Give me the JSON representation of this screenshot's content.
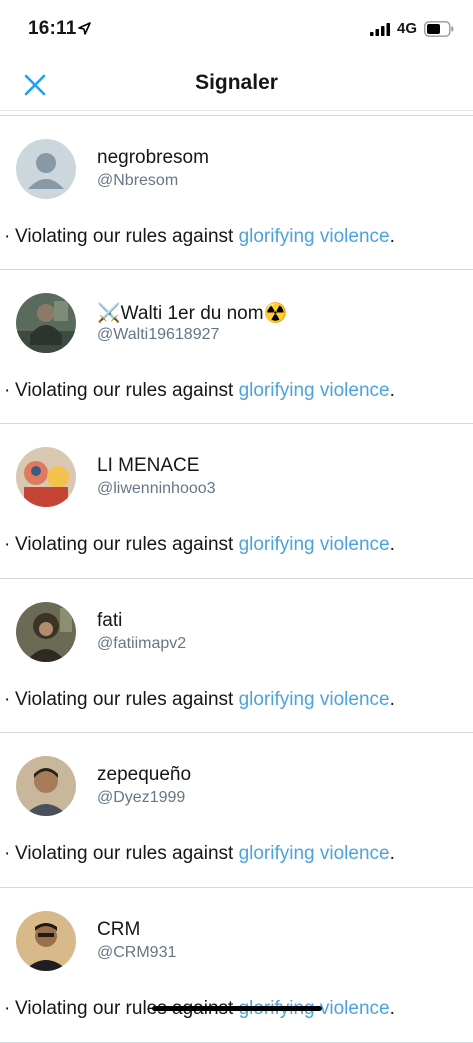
{
  "status_bar": {
    "time": "16:11",
    "network": "4G"
  },
  "header": {
    "title": "Signaler"
  },
  "reason": {
    "prefix": "Violating our rules against ",
    "link": "glorifying violence",
    "suffix": "."
  },
  "accounts": [
    {
      "name": "negrobresom",
      "handle": "@Nbresom",
      "avatar": "default"
    },
    {
      "name": "⚔️Walti 1er du nom☢️",
      "handle": "@Walti19618927",
      "avatar": "photo"
    },
    {
      "name": "LI MENACE",
      "handle": "@liwenninhooo3",
      "avatar": "photo"
    },
    {
      "name": "fati",
      "handle": "@fatiimapv2",
      "avatar": "photo"
    },
    {
      "name": "zepequeño",
      "handle": "@Dyez1999",
      "avatar": "photo"
    },
    {
      "name": "CRM",
      "handle": "@CRM931",
      "avatar": "photo"
    }
  ],
  "colors": {
    "accent": "#1da1f2",
    "link": "#4aa3df",
    "secondary_text": "#657786"
  }
}
